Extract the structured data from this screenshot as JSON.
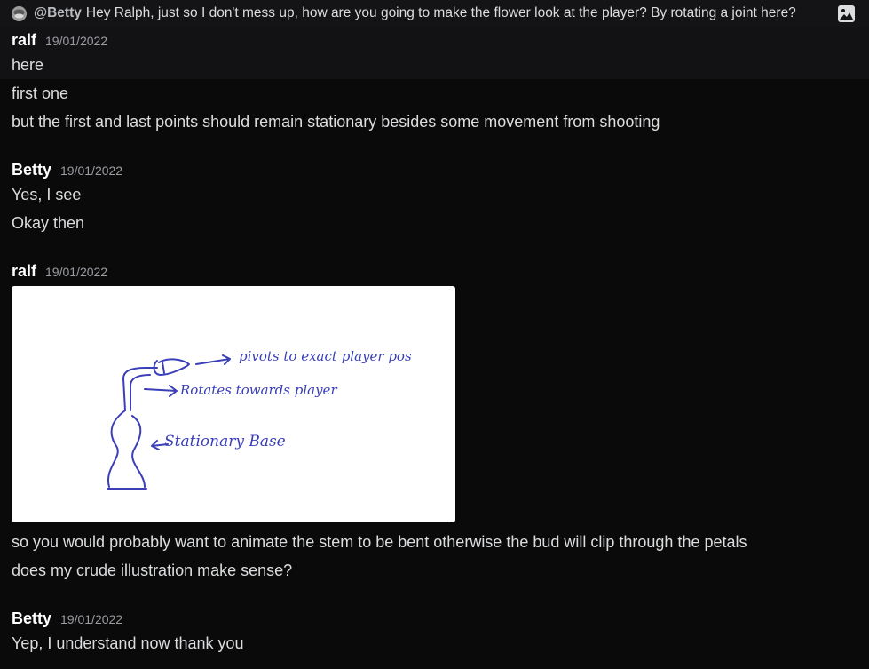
{
  "reply": {
    "mention": "@Betty",
    "text": "Hey Ralph, just so I don't mess up, how are you going to make the flower look at the player? By rotating a joint here?",
    "attachment_icon": "image-icon"
  },
  "messages": [
    {
      "author": "ralf",
      "timestamp": "19/01/2022",
      "lines": [
        "here",
        "first one",
        "but the first and last points should remain stationary besides some movement from shooting"
      ]
    },
    {
      "author": "Betty",
      "timestamp": "19/01/2022",
      "lines": [
        "Yes, I see",
        "Okay then"
      ]
    },
    {
      "author": "ralf",
      "timestamp": "19/01/2022",
      "attachment": {
        "annotations": [
          "pivots to exact player pos",
          "Rotates towards player",
          "Stationary Base"
        ]
      },
      "lines": [
        "so you would probably want to animate the stem to be bent otherwise the bud will clip through the petals",
        "does my crude illustration make sense?"
      ]
    },
    {
      "author": "Betty",
      "timestamp": "19/01/2022",
      "lines": [
        "Yep, I understand now thank you"
      ]
    }
  ]
}
